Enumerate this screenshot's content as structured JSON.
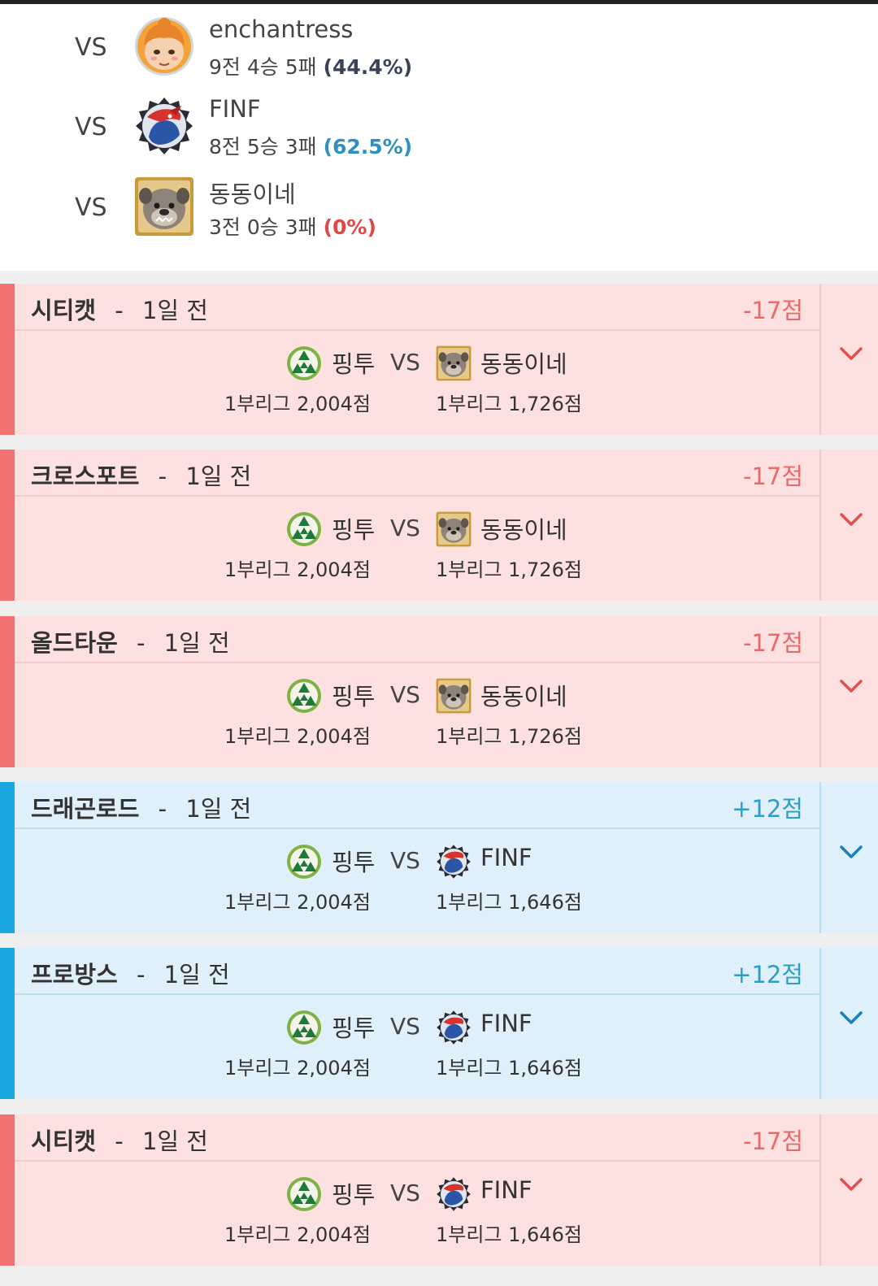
{
  "opponents": [
    {
      "vs": "VS",
      "name": "enchantress",
      "record": "9전 4승 5패",
      "pct": "(44.4%)",
      "pct_color": "#3a4454",
      "avatar": "girl-avatar-icon"
    },
    {
      "vs": "VS",
      "name": "FINF",
      "record": "8전 5승 3패",
      "pct": "(62.5%)",
      "pct_color": "#2f8fbf",
      "avatar": "dragon-emblem-icon"
    },
    {
      "vs": "VS",
      "name": "동동이네",
      "record": "3전 0승 3패",
      "pct": "(0%)",
      "pct_color": "#e04848",
      "avatar": "bulldog-emblem-icon"
    }
  ],
  "matches": [
    {
      "result": "loss",
      "map": "시티캣",
      "time": "1일 전",
      "delta": "-17점",
      "p1": "핑투",
      "p1_score": "1부리그 2,004점",
      "vs": "VS",
      "p2": "동동이네",
      "p2_score": "1부리그 1,726점"
    },
    {
      "result": "loss",
      "map": "크로스포트",
      "time": "1일 전",
      "delta": "-17점",
      "p1": "핑투",
      "p1_score": "1부리그 2,004점",
      "vs": "VS",
      "p2": "동동이네",
      "p2_score": "1부리그 1,726점"
    },
    {
      "result": "loss",
      "map": "올드타운",
      "time": "1일 전",
      "delta": "-17점",
      "p1": "핑투",
      "p1_score": "1부리그 2,004점",
      "vs": "VS",
      "p2": "동동이네",
      "p2_score": "1부리그 1,726점"
    },
    {
      "result": "win",
      "map": "드래곤로드",
      "time": "1일 전",
      "delta": "+12점",
      "p1": "핑투",
      "p1_score": "1부리그 2,004점",
      "vs": "VS",
      "p2": "FINF",
      "p2_score": "1부리그 1,646점"
    },
    {
      "result": "win",
      "map": "프로방스",
      "time": "1일 전",
      "delta": "+12점",
      "p1": "핑투",
      "p1_score": "1부리그 2,004점",
      "vs": "VS",
      "p2": "FINF",
      "p2_score": "1부리그 1,646점"
    },
    {
      "result": "loss",
      "map": "시티캣",
      "time": "1일 전",
      "delta": "-17점",
      "p1": "핑투",
      "p1_score": "1부리그 2,004점",
      "vs": "VS",
      "p2": "FINF",
      "p2_score": "1부리그 1,646점"
    }
  ],
  "separator": "-",
  "colors": {
    "loss": "#f27171",
    "win": "#1ba8e0",
    "loss_bg": "#fde0e0",
    "win_bg": "#dff0fb"
  }
}
